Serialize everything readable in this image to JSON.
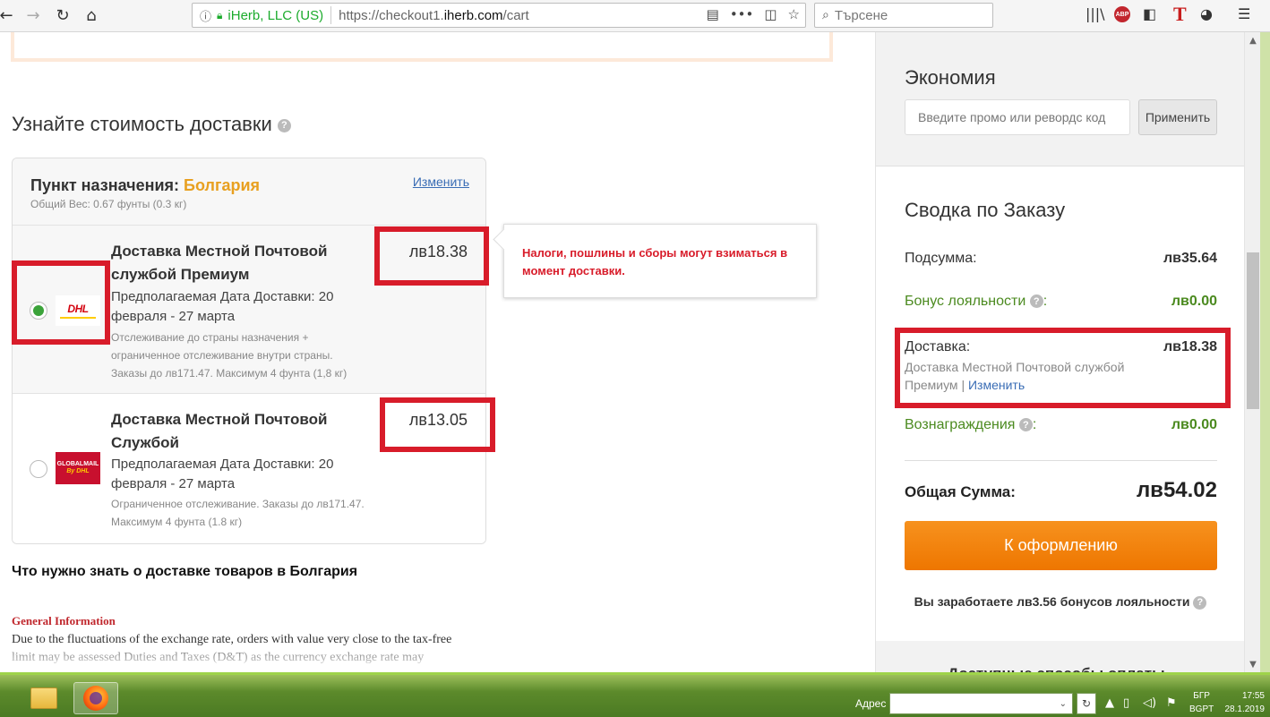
{
  "browser": {
    "site_identity": "iHerb, LLC (US)",
    "url_prefix": "https://checkout1.",
    "url_domain": "iherb.com",
    "url_path": "/cart",
    "search_placeholder": "Търсене",
    "abp_label": "ABP",
    "t_label": "T"
  },
  "delivery": {
    "title": "Узнайте стоимость доставки",
    "help": "?",
    "destination_label": "Пункт назначения:",
    "destination_country": "Болгария",
    "change_link": "Изменить",
    "weight": "Общий Вес: 0.67 фунты (0.3 кг)",
    "options": [
      {
        "title": "Доставка Местной Почтовой службой Премиум",
        "date": "Предполагаемая Дата Доставки: 20 февраля - 27 марта",
        "note": "Отслеживание до страны назначения + ограниченное отслеживание внутри страны. Заказы до лв171.47. Максимум 4 фунта (1,8 кг)",
        "price": "лв18.38",
        "logo_text": "DHL",
        "selected": true
      },
      {
        "title": "Доставка Местной Почтовой Службой",
        "date": "Предполагаемая Дата Доставки: 20 февраля - 27 марта",
        "note": "Ограниченное отслеживание. Заказы до лв171.47. Максимум 4 фунта (1.8 кг)",
        "price": "лв13.05",
        "logo_text": "GLOBALMAIL",
        "logo_sub": "By DHL",
        "selected": false
      }
    ],
    "tooltip": "Налоги, пошлины и сборы могут взиматься в момент доставки."
  },
  "info": {
    "heading": "Что нужно знать о доставке товаров в Болгария",
    "general_title": "General Information",
    "general_text": "Due to the fluctuations of the exchange rate, orders with value very close to the tax-free limit may be assessed Duties and Taxes (D&T) as the currency exchange rate may"
  },
  "sidebar": {
    "savings_title": "Экономия",
    "promo_placeholder": "Введите промо или ревордс код",
    "apply_button": "Применить",
    "summary_title": "Сводка по Заказу",
    "subtotal_label": "Подсумма:",
    "subtotal_value": "лв35.64",
    "loyalty_label": "Бонус лояльности",
    "loyalty_value": "лв0.00",
    "shipping_label": "Доставка:",
    "shipping_value": "лв18.38",
    "shipping_method": "Доставка Местной Почтовой службой Премиум",
    "shipping_change": "Изменить",
    "rewards_label": "Вознаграждения",
    "rewards_value": "лв0.00",
    "total_label": "Общая Сумма:",
    "total_value": "лв54.02",
    "checkout_button": "К оформлению",
    "earn_text": "Вы заработаете лв3.56 бонусов лояльности",
    "payment_heading": "Доступные способы оплаты"
  },
  "colors": {
    "accent_orange": "#ee7600",
    "loyalty_green": "#4b8a1f",
    "highlight_red": "#d81c2a",
    "link_blue": "#3a6db5"
  },
  "taskbar": {
    "address_label": "Адрес",
    "lang_top": "БГР",
    "lang_bottom": "BGPT",
    "time": "17:55",
    "date": "28.1.2019"
  }
}
